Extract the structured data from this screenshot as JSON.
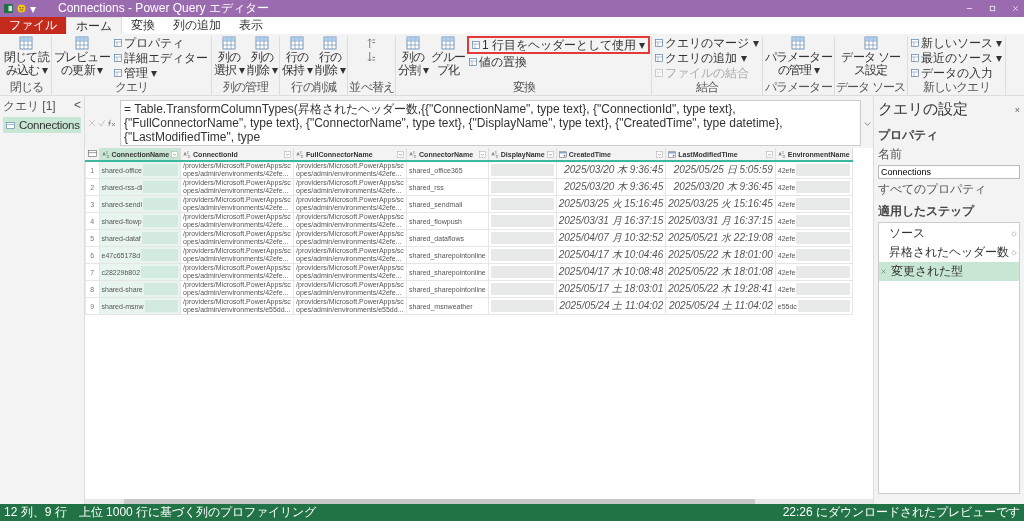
{
  "window": {
    "title": "Connections - Power Query エディター",
    "quick_access": "▾"
  },
  "tabs": [
    {
      "label": "ファイル",
      "kind": "file",
      "selected": false
    },
    {
      "label": "ホーム",
      "kind": "tab",
      "selected": true
    },
    {
      "label": "変換",
      "kind": "tab",
      "selected": false
    },
    {
      "label": "列の追加",
      "kind": "tab",
      "selected": false
    },
    {
      "label": "表示",
      "kind": "tab",
      "selected": false
    }
  ],
  "ribbon": {
    "groups": [
      {
        "label": "閉じる",
        "items": [
          {
            "kind": "large",
            "lines": [
              "閉じて読",
              "み込む ▾"
            ]
          }
        ]
      },
      {
        "label": "クエリ",
        "items": [
          {
            "kind": "large",
            "lines": [
              "プレビュー",
              "の更新 ▾"
            ]
          },
          {
            "kind": "stack",
            "items": [
              {
                "label": "プロパティ",
                "highlighted": false,
                "disabled": false
              },
              {
                "label": "詳細エディター",
                "highlighted": false,
                "disabled": false
              },
              {
                "label": "管理 ▾",
                "highlighted": false,
                "disabled": false
              }
            ]
          }
        ]
      },
      {
        "label": "列の管理",
        "items": [
          {
            "kind": "large",
            "lines": [
              "列の",
              "選択 ▾"
            ]
          },
          {
            "kind": "large",
            "lines": [
              "列の",
              "削除 ▾"
            ]
          }
        ]
      },
      {
        "label": "行の削減",
        "items": [
          {
            "kind": "large",
            "lines": [
              "行の",
              "保持 ▾"
            ]
          },
          {
            "kind": "large",
            "lines": [
              "行の",
              "削除 ▾"
            ]
          }
        ]
      },
      {
        "label": "並べ替え",
        "items": [
          {
            "kind": "sort"
          }
        ]
      },
      {
        "label": "変換",
        "items": [
          {
            "kind": "large",
            "lines": [
              "列の",
              "分割 ▾"
            ]
          },
          {
            "kind": "large",
            "lines": [
              "グルー",
              "プ化"
            ]
          },
          {
            "kind": "stack",
            "items": [
              {
                "label": "1 行目をヘッダーとして使用 ▾",
                "highlighted": true,
                "disabled": false
              },
              {
                "label": "値の置換",
                "highlighted": false,
                "disabled": false
              }
            ]
          }
        ]
      },
      {
        "label": "結合",
        "items": [
          {
            "kind": "stack",
            "items": [
              {
                "label": "クエリのマージ ▾",
                "highlighted": false,
                "disabled": false
              },
              {
                "label": "クエリの追加 ▾",
                "highlighted": false,
                "disabled": false
              },
              {
                "label": "ファイルの結合",
                "highlighted": false,
                "disabled": true
              }
            ]
          }
        ]
      },
      {
        "label": "パラメーター",
        "items": [
          {
            "kind": "large",
            "lines": [
              "パラメーター",
              "の管理 ▾"
            ]
          }
        ]
      },
      {
        "label": "データ ソース",
        "items": [
          {
            "kind": "large",
            "lines": [
              "データ ソー",
              "ス設定"
            ]
          }
        ]
      },
      {
        "label": "新しいクエリ",
        "items": [
          {
            "kind": "stack",
            "items": [
              {
                "label": "新しいソース ▾",
                "highlighted": false,
                "disabled": false
              },
              {
                "label": "最近のソース ▾",
                "highlighted": false,
                "disabled": false
              },
              {
                "label": "データの入力",
                "highlighted": false,
                "disabled": false
              }
            ]
          }
        ]
      }
    ]
  },
  "queries_pane": {
    "title": "クエリ [1]",
    "collapse": "<",
    "items": [
      {
        "label": "Connections",
        "selected": true
      }
    ]
  },
  "formula_bar": {
    "formula": "= Table.TransformColumnTypes(昇格されたヘッダー数,{{\"ConnectionName\", type text}, {\"ConnectionId\", type text}, {\"FullConnectorName\", type text}, {\"ConnectorName\", type text}, {\"DisplayName\", type text}, {\"CreatedTime\", type datetime}, {\"LastModifiedTime\", type"
  },
  "table": {
    "columns": [
      {
        "name": "ConnectionName",
        "kind": "text",
        "selected": true,
        "redacted": true
      },
      {
        "name": "ConnectionId",
        "kind": "text",
        "selected": false,
        "redacted": false
      },
      {
        "name": "FullConnectorName",
        "kind": "text",
        "selected": false,
        "redacted": false
      },
      {
        "name": "ConnectorName",
        "kind": "text",
        "selected": false,
        "redacted": false
      },
      {
        "name": "DisplayName",
        "kind": "text",
        "selected": false,
        "redacted": true
      },
      {
        "name": "CreatedTime",
        "kind": "datetime",
        "selected": false,
        "redacted": false
      },
      {
        "name": "LastModifiedTime",
        "kind": "datetime",
        "selected": false,
        "redacted": false
      },
      {
        "name": "EnvironmentName",
        "kind": "text",
        "selected": false,
        "redacted": true
      }
    ],
    "rows": [
      {
        "number": "1",
        "cells": [
          "shared-office",
          "/providers/Microsoft.PowerApps/scopes/admin/environments/42efe...",
          "/providers/Microsoft.PowerApps/scopes/admin/environments/42efe...",
          "shared_office365",
          "",
          "2025/03/20 木 9:36:45",
          "2025/05/25 日 5:05:59",
          "42efe"
        ]
      },
      {
        "number": "2",
        "cells": [
          "shared-rss-di",
          "/providers/Microsoft.PowerApps/scopes/admin/environments/42efe...",
          "/providers/Microsoft.PowerApps/scopes/admin/environments/42efe...",
          "shared_rss",
          "",
          "2025/03/20 木 9:36:45",
          "2025/03/20 木 9:36:45",
          "42efe"
        ]
      },
      {
        "number": "3",
        "cells": [
          "shared-sendi",
          "/providers/Microsoft.PowerApps/scopes/admin/environments/42efe...",
          "/providers/Microsoft.PowerApps/scopes/admin/environments/42efe...",
          "shared_sendmail",
          "",
          "2025/03/25 火 15:16:45",
          "2025/03/25 火 15:16:45",
          "42efe"
        ]
      },
      {
        "number": "4",
        "cells": [
          "shared-flowp",
          "/providers/Microsoft.PowerApps/scopes/admin/environments/42efe...",
          "/providers/Microsoft.PowerApps/scopes/admin/environments/42efe...",
          "shared_flowpush",
          "",
          "2025/03/31 月 16:37:15",
          "2025/03/31 月 16:37:15",
          "42efe"
        ]
      },
      {
        "number": "5",
        "cells": [
          "shared-dataf",
          "/providers/Microsoft.PowerApps/scopes/admin/environments/42efe...",
          "/providers/Microsoft.PowerApps/scopes/admin/environments/42efe...",
          "shared_dataflows",
          "",
          "2025/04/07 月 10:32:52",
          "2025/05/21 水 22:19:08",
          "42efe"
        ]
      },
      {
        "number": "6",
        "cells": [
          "e47c65178d",
          "/providers/Microsoft.PowerApps/scopes/admin/environments/42efe...",
          "/providers/Microsoft.PowerApps/scopes/admin/environments/42efe...",
          "shared_sharepointonline",
          "",
          "2025/04/17 木 10:04:46",
          "2025/05/22 木 18:01:00",
          "42efe"
        ]
      },
      {
        "number": "7",
        "cells": [
          "c28229b802",
          "/providers/Microsoft.PowerApps/scopes/admin/environments/42efe...",
          "/providers/Microsoft.PowerApps/scopes/admin/environments/42efe...",
          "shared_sharepointonline",
          "",
          "2025/04/17 木 10:08:48",
          "2025/05/22 木 18:01:08",
          "42efe"
        ]
      },
      {
        "number": "8",
        "cells": [
          "shared-share",
          "/providers/Microsoft.PowerApps/scopes/admin/environments/42efe...",
          "/providers/Microsoft.PowerApps/scopes/admin/environments/42efe...",
          "shared_sharepointonline",
          "",
          "2025/05/17 土 18:03:01",
          "2025/05/22 木 19:28:41",
          "42efe"
        ]
      },
      {
        "number": "9",
        "cells": [
          "shared-msnw",
          "/providers/Microsoft.PowerApps/scopes/admin/environments/e55dd...",
          "/providers/Microsoft.PowerApps/scopes/admin/environments/e55dd...",
          "shared_msnweather",
          "",
          "2025/05/24 土 11:04:02",
          "2025/05/24 土 11:04:02",
          "e55dc"
        ]
      }
    ]
  },
  "settings_pane": {
    "title": "クエリの設定",
    "close": "×",
    "properties_heading": "プロパティ",
    "name_label": "名前",
    "name_value": "Connections",
    "all_properties": "すべてのプロパティ",
    "steps_heading": "適用したステップ",
    "steps": [
      {
        "label": "ソース",
        "has_settings": true,
        "selected": false
      },
      {
        "label": "昇格されたヘッダー数",
        "has_settings": true,
        "selected": false
      },
      {
        "label": "変更された型",
        "has_settings": false,
        "selected": true
      }
    ]
  },
  "status_bar": {
    "left": "12 列、9 行",
    "profiling": "上位 1000 行に基づく列のプロファイリング",
    "right": "22:26 にダウンロードされたプレビューです"
  }
}
